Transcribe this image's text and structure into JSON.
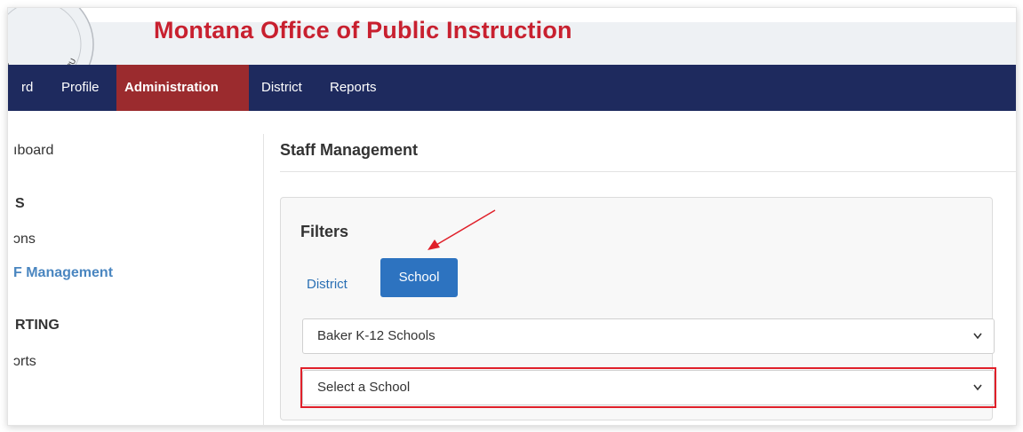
{
  "header": {
    "site_title": "Montana Office of Public Instruction",
    "seal_text": "ICE OF PUBLIC INSTRU"
  },
  "navbar": {
    "items": [
      {
        "label": "rd"
      },
      {
        "label": "Profile"
      },
      {
        "label": "Administration",
        "active": true
      },
      {
        "label": "District"
      },
      {
        "label": "Reports"
      }
    ]
  },
  "sidebar": {
    "dashboard": "ıboard",
    "section1_heading": "S",
    "item_ons": "ɔns",
    "item_staff": "F Management",
    "section2_heading": "RTING",
    "item_reports": "ɔrts"
  },
  "main": {
    "page_title": "Staff Management",
    "filters": {
      "title": "Filters",
      "district_label": "District",
      "school_label": "School",
      "district_select_value": "Baker K-12 Schools",
      "school_select_value": "Select a School"
    }
  },
  "colors": {
    "navbar_bg": "#1e2a5e",
    "nav_active_bg": "#9b2b2e",
    "brand_red": "#c8202f",
    "primary_blue": "#2d73c0",
    "highlight_red": "#e0202a"
  }
}
